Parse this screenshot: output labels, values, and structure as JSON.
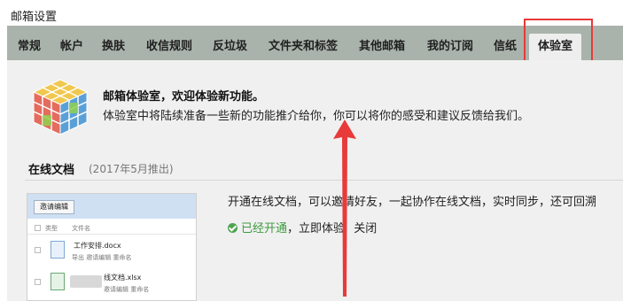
{
  "page": {
    "title": "邮箱设置"
  },
  "tabs": [
    {
      "label": "常规"
    },
    {
      "label": "帐户"
    },
    {
      "label": "换肤"
    },
    {
      "label": "收信规则"
    },
    {
      "label": "反垃圾"
    },
    {
      "label": "文件夹和标签"
    },
    {
      "label": "其他邮箱"
    },
    {
      "label": "我的订阅"
    },
    {
      "label": "信纸"
    },
    {
      "label": "体验室",
      "active": true
    }
  ],
  "lab": {
    "title": "邮箱体验室，欢迎体验新功能。",
    "description": "体验室中将陆续准备一些新的功能推介给你，你可以将你的感受和建议反馈给我们。",
    "icon": "rubiks-cube-icon"
  },
  "feature": {
    "name": "在线文档",
    "launch": "(2017年5月推出)",
    "description": "开通在线文档，可以邀请好友，一起协作在线文档，实时同步，还可回溯",
    "status": "已经开通",
    "separator": "，",
    "try_label": "立即体验",
    "close_label": "关闭",
    "preview": {
      "invite_button": "邀请编辑",
      "col_type": "类型",
      "col_name": "文件名",
      "files": [
        {
          "name": "工作安排.docx",
          "actions": "导出   邀请编辑   重命名"
        },
        {
          "name": "线文档.xlsx",
          "actions": "邀请编辑   重命名"
        }
      ]
    }
  },
  "colors": {
    "tabbar": "#a9b3ab",
    "content_bg": "#f0f0f0",
    "highlight": "#e83a3a",
    "enabled": "#3e9a3e"
  }
}
